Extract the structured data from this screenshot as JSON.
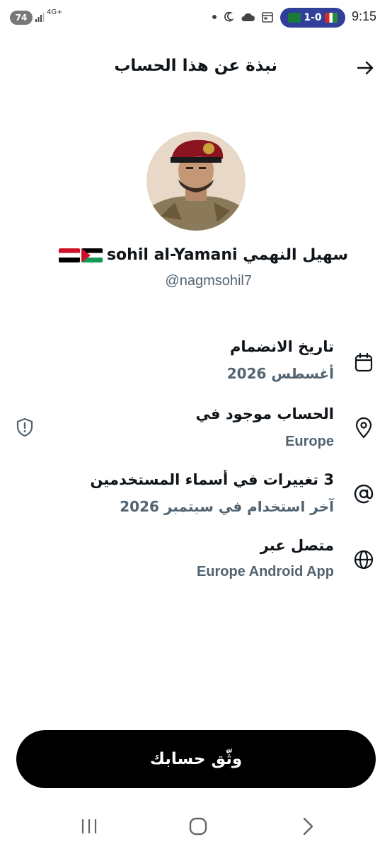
{
  "status_bar": {
    "battery": "74",
    "network": "4G+",
    "score": "1-0",
    "time": "9:15"
  },
  "header": {
    "title": "نبذة عن هذا الحساب"
  },
  "profile": {
    "display_name": "سهيل النهمي sohil al-Yamani",
    "handle": "@nagmsohil7"
  },
  "info": {
    "joined_title": "تاريخ الانضمام",
    "joined_value": "أغسطس 2026",
    "location_title": "الحساب موجود في",
    "location_value": "Europe",
    "username_changes_title": "3 تغييرات في أسماء المستخدمين",
    "username_changes_value": "آخر استخدام في سبتمبر 2026",
    "connected_title": "متصل عبر",
    "connected_value": "Europe Android App"
  },
  "actions": {
    "verify_label": "وثّق حسابك"
  },
  "colors": {
    "secondary_text": "#536471",
    "button_bg": "#000000"
  }
}
